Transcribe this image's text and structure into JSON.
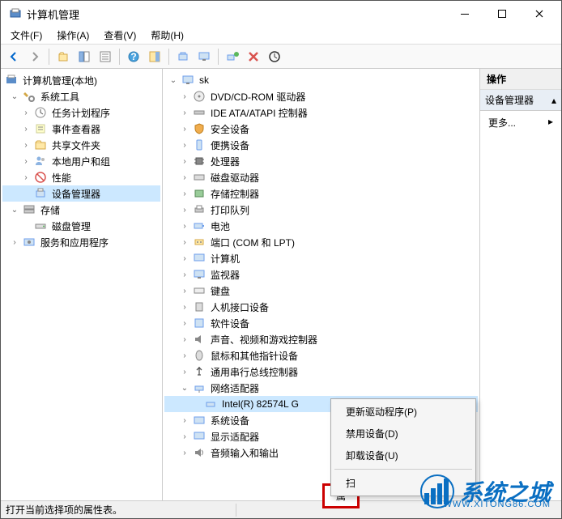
{
  "title": "计算机管理",
  "menu": {
    "file": "文件(F)",
    "action": "操作(A)",
    "view": "查看(V)",
    "help": "帮助(H)"
  },
  "left_tree": {
    "root": "计算机管理(本地)",
    "system_tools": "系统工具",
    "task_scheduler": "任务计划程序",
    "event_viewer": "事件查看器",
    "shared_folders": "共享文件夹",
    "local_users": "本地用户和组",
    "performance": "性能",
    "device_manager": "设备管理器",
    "storage": "存储",
    "disk_mgmt": "磁盘管理",
    "services_apps": "服务和应用程序"
  },
  "mid_tree": {
    "root": "sk",
    "dvd": "DVD/CD-ROM 驱动器",
    "ide": "IDE ATA/ATAPI 控制器",
    "security": "安全设备",
    "portable": "便携设备",
    "processors": "处理器",
    "disk_drives": "磁盘驱动器",
    "storage_ctrl": "存储控制器",
    "print_queues": "打印队列",
    "batteries": "电池",
    "ports": "端口 (COM 和 LPT)",
    "computer": "计算机",
    "monitors": "监视器",
    "keyboards": "键盘",
    "hid": "人机接口设备",
    "software": "软件设备",
    "sound": "声音、视频和游戏控制器",
    "mouse": "鼠标和其他指针设备",
    "usb": "通用串行总线控制器",
    "network": "网络适配器",
    "nic": "Intel(R) 82574L G",
    "system_devices": "系统设备",
    "display": "显示适配器",
    "audio_io": "音频输入和输出"
  },
  "right": {
    "header": "操作",
    "section": "设备管理器",
    "more": "更多..."
  },
  "context_menu": {
    "update": "更新驱动程序(P)",
    "disable": "禁用设备(D)",
    "uninstall": "卸载设备(U)",
    "scan_partial": "扫",
    "prop_partial": "属"
  },
  "watermark": {
    "text": "系统之城",
    "sub": "WWW.XITONG86.COM"
  },
  "statusbar": "打开当前选择项的属性表。"
}
